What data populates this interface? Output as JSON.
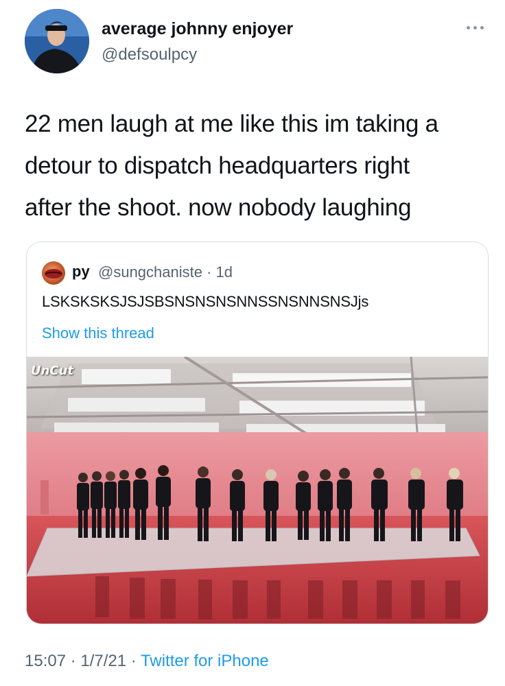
{
  "author": {
    "display_name": "average johnny enjoyer",
    "handle": "@defsoulpcy",
    "avatar_icon": "profile-photo"
  },
  "menu_icon": "more-dots-icon",
  "tweet": {
    "line1": "22 men laugh at me like this im taking a",
    "line2": "detour to dispatch headquarters right",
    "line3": "after the shoot. now nobody laughing"
  },
  "quoted": {
    "name": "py",
    "handle_time": "@sungchaniste · 1d",
    "text": "LSKSKSKSJSJSBSNSNSNSNNSSNSNNSNSJjs",
    "show_thread": "Show this thread",
    "media_watermark": "UnCut"
  },
  "footer": {
    "time": "15:07 · 1/7/21",
    "separator": " · ",
    "source": "Twitter for iPhone"
  },
  "colors": {
    "link": "#1d9bf0",
    "secondary": "#536471",
    "wall": "#e98d95",
    "floor": "#c93f45"
  }
}
